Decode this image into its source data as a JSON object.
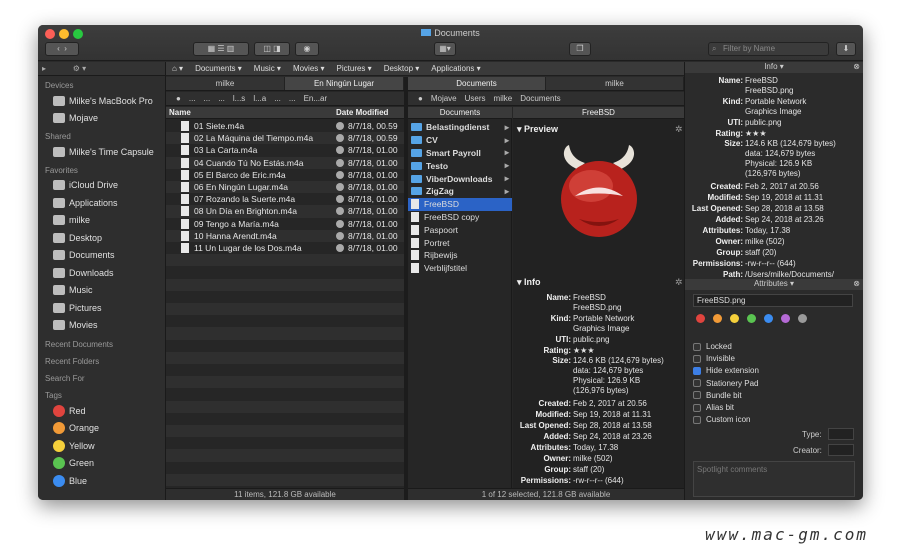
{
  "window": {
    "title": "Documents"
  },
  "toolbar": {
    "search_placeholder": "Filter by Name"
  },
  "pathbar": {
    "items": [
      "Documents",
      "Music",
      "Movies",
      "Pictures",
      "Desktop",
      "Applications"
    ]
  },
  "sidebar": {
    "devices_header": "Devices",
    "devices": [
      "Milke's MacBook Pro",
      "Mojave"
    ],
    "shared_header": "Shared",
    "shared": [
      "Milke's Time Capsule"
    ],
    "favorites_header": "Favorites",
    "favorites": [
      "iCloud Drive",
      "Applications",
      "milke",
      "Desktop",
      "Documents",
      "Downloads",
      "Music",
      "Pictures",
      "Movies"
    ],
    "recent_documents": "Recent Documents",
    "recent_folders": "Recent Folders",
    "search_for": "Search For",
    "tags_header": "Tags",
    "tags": [
      {
        "name": "Red",
        "color": "#e0443e"
      },
      {
        "name": "Orange",
        "color": "#f19a37"
      },
      {
        "name": "Yellow",
        "color": "#f5d03b"
      },
      {
        "name": "Green",
        "color": "#5ac451"
      },
      {
        "name": "Blue",
        "color": "#3b8cf0"
      }
    ]
  },
  "left_pane": {
    "tabs": [
      "milke",
      "En Ningún Lugar"
    ],
    "crumbs": [
      "...",
      "...",
      "...",
      "l...s",
      "l...a",
      "...",
      "...",
      "En...ar"
    ],
    "col_name": "Name",
    "col_date": "Date Modified",
    "files": [
      {
        "name": "01 Siete.m4a",
        "date": "8/7/18, 00.59"
      },
      {
        "name": "02 La Máquina del Tiempo.m4a",
        "date": "8/7/18, 00.59"
      },
      {
        "name": "03 La Carta.m4a",
        "date": "8/7/18, 01.00"
      },
      {
        "name": "04 Cuando Tú No Estás.m4a",
        "date": "8/7/18, 01.00"
      },
      {
        "name": "05 El Barco de Eric.m4a",
        "date": "8/7/18, 01.00"
      },
      {
        "name": "06 En Ningún Lugar.m4a",
        "date": "8/7/18, 01.00"
      },
      {
        "name": "07 Rozando la Suerte.m4a",
        "date": "8/7/18, 01.00"
      },
      {
        "name": "08 Un Día en Brighton.m4a",
        "date": "8/7/18, 01.00"
      },
      {
        "name": "09 Tengo a María.m4a",
        "date": "8/7/18, 01.00"
      },
      {
        "name": "10 Hanna Arendt.m4a",
        "date": "8/7/18, 01.00"
      },
      {
        "name": "11 Un Lugar de los Dos.m4a",
        "date": "8/7/18, 01.00"
      }
    ],
    "status": "11 items, 121.8 GB available"
  },
  "right_pane": {
    "tabs": [
      "Documents",
      "milke"
    ],
    "crumbs": [
      "Mojave",
      "Users",
      "milke",
      "Documents"
    ],
    "col1_header": "Documents",
    "col2_header": "FreeBSD",
    "folders": [
      {
        "name": "Belastingdienst",
        "type": "folder"
      },
      {
        "name": "CV",
        "type": "folder"
      },
      {
        "name": "Smart Payroll",
        "type": "folder"
      },
      {
        "name": "Testo",
        "type": "folder"
      },
      {
        "name": "ViberDownloads",
        "type": "folder"
      },
      {
        "name": "ZigZag",
        "type": "folder"
      },
      {
        "name": "FreeBSD",
        "type": "file"
      },
      {
        "name": "FreeBSD copy",
        "type": "file"
      },
      {
        "name": "Paspoort",
        "type": "file"
      },
      {
        "name": "Portret",
        "type": "file"
      },
      {
        "name": "Rijbewijs",
        "type": "file"
      },
      {
        "name": "Verblijfstitel",
        "type": "file"
      }
    ],
    "preview_label": "Preview",
    "info_label": "Info",
    "status": "1 of 12 selected, 121.8 GB available"
  },
  "info": {
    "panel_title": "Info",
    "fields": [
      {
        "k": "Name:",
        "v": "FreeBSD\nFreeBSD.png"
      },
      {
        "k": "Kind:",
        "v": "Portable Network\nGraphics Image"
      },
      {
        "k": "UTI:",
        "v": "public.png"
      },
      {
        "k": "Rating:",
        "v": "★★★"
      },
      {
        "k": "Size:",
        "v": "124.6 KB (124,679 bytes)\ndata: 124,679 bytes\nPhysical: 126.9 KB\n(126,976 bytes)"
      },
      {
        "k": "Created:",
        "v": "Feb 2, 2017 at 20.56"
      },
      {
        "k": "Modified:",
        "v": "Sep 19, 2018 at 11.31"
      },
      {
        "k": "Last Opened:",
        "v": "Sep 28, 2018 at 13.58"
      },
      {
        "k": "Added:",
        "v": "Sep 24, 2018 at 23.26"
      },
      {
        "k": "Attributes:",
        "v": "Today, 17.38"
      },
      {
        "k": "Owner:",
        "v": "milke (502)"
      },
      {
        "k": "Group:",
        "v": "staff (20)"
      },
      {
        "k": "Permissions:",
        "v": "-rw-r--r-- (644)"
      },
      {
        "k": "Path:",
        "v": "/Users/milke/Documents/"
      }
    ]
  },
  "attributes": {
    "panel_title": "Attributes",
    "filename": "FreeBSD.png",
    "color_dots": [
      "#e0443e",
      "#f19a37",
      "#f5d03b",
      "#5ac451",
      "#3b8cf0",
      "#b56ad6",
      "#9a9a9a"
    ],
    "checkboxes": [
      {
        "label": "Locked",
        "checked": false
      },
      {
        "label": "Invisible",
        "checked": false
      },
      {
        "label": "Hide extension",
        "checked": true
      },
      {
        "label": "Stationery Pad",
        "checked": false
      },
      {
        "label": "Bundle bit",
        "checked": false
      },
      {
        "label": "Alias bit",
        "checked": false
      },
      {
        "label": "Custom icon",
        "checked": false
      }
    ],
    "type_label": "Type:",
    "creator_label": "Creator:",
    "comments_placeholder": "Spotlight comments"
  },
  "watermark": "www.mac-gm.com"
}
